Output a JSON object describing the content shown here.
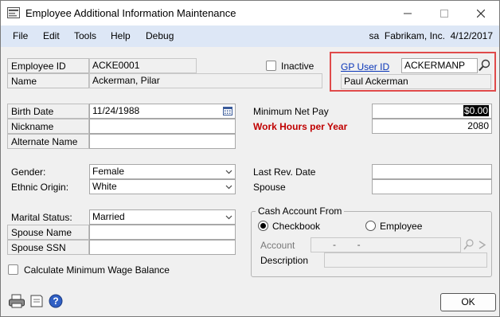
{
  "window": {
    "title": "Employee Additional Information Maintenance"
  },
  "menu": {
    "items": [
      "File",
      "Edit",
      "Tools",
      "Help",
      "Debug"
    ],
    "user": "sa",
    "company": "Fabrikam, Inc.",
    "date": "4/12/2017"
  },
  "header": {
    "employee_id_label": "Employee ID",
    "employee_id": "ACKE0001",
    "name_label": "Name",
    "name": "Ackerman, Pilar",
    "inactive_label": "Inactive",
    "inactive": false,
    "gp_user_id_label": "GP User ID",
    "gp_user_id": "ACKERMANP",
    "gp_user_name": "Paul Ackerman"
  },
  "left": {
    "birth_date_label": "Birth Date",
    "birth_date": "11/24/1988",
    "nickname_label": "Nickname",
    "nickname": "",
    "alternate_name_label": "Alternate Name",
    "alternate_name": "",
    "gender_label": "Gender:",
    "gender": "Female",
    "ethnic_label": "Ethnic Origin:",
    "ethnic": "White",
    "marital_label": "Marital Status:",
    "marital": "Married",
    "spouse_name_label": "Spouse Name",
    "spouse_name": "",
    "spouse_ssn_label": "Spouse SSN",
    "spouse_ssn": "",
    "calc_min_wage_label": "Calculate Minimum Wage Balance",
    "calc_min_wage": false
  },
  "right": {
    "min_net_pay_label": "Minimum Net Pay",
    "min_net_pay": "$0.00",
    "work_hours_label": "Work Hours per Year",
    "work_hours": "2080",
    "last_rev_date_label": "Last Rev. Date",
    "last_rev_date": "",
    "spouse_label": "Spouse",
    "spouse": ""
  },
  "cash": {
    "group_label": "Cash Account From",
    "checkbook_label": "Checkbook",
    "employee_label": "Employee",
    "selected": "Checkbook",
    "account_label": "Account",
    "account_value": "-        -",
    "description_label": "Description",
    "description": ""
  },
  "footer": {
    "ok_label": "OK"
  },
  "colors": {
    "menubar": "#dde7f6",
    "highlight": "#e04a4a",
    "link": "#0a36b8",
    "required": "#c00000"
  }
}
